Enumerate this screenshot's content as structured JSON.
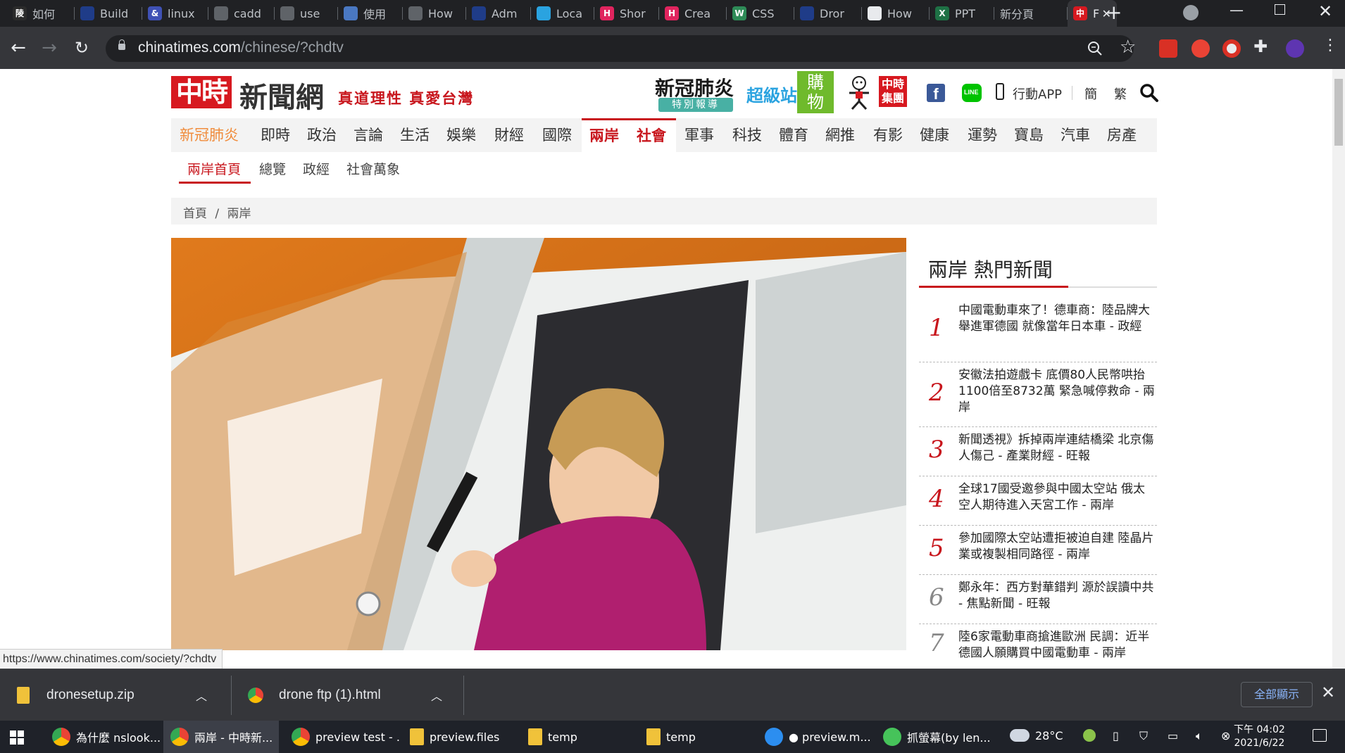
{
  "browser": {
    "tabs": [
      {
        "label": "如何",
        "fav_color": "#2b2b2b",
        "fav_glyph": "陵"
      },
      {
        "label": "Build",
        "fav_color": "#1f3c88",
        "fav_glyph": ""
      },
      {
        "label": "linux",
        "fav_color": "#3f51b5",
        "fav_glyph": "&"
      },
      {
        "label": "cadd",
        "fav_color": "#5f6368",
        "fav_glyph": ""
      },
      {
        "label": "use",
        "fav_color": "#5f6368",
        "fav_glyph": ""
      },
      {
        "label": "使用",
        "fav_color": "#4a78c2",
        "fav_glyph": ""
      },
      {
        "label": "How",
        "fav_color": "#5f6368",
        "fav_glyph": ""
      },
      {
        "label": "Adm",
        "fav_color": "#1f3c88",
        "fav_glyph": ""
      },
      {
        "label": "Loca",
        "fav_color": "#2aa3e0",
        "fav_glyph": ""
      },
      {
        "label": "Shor",
        "fav_color": "#e0245e",
        "fav_glyph": "H"
      },
      {
        "label": "Crea",
        "fav_color": "#e0245e",
        "fav_glyph": "H"
      },
      {
        "label": "CSS",
        "fav_color": "#2e8b57",
        "fav_glyph": "W"
      },
      {
        "label": "Dror",
        "fav_color": "#1f3c88",
        "fav_glyph": ""
      },
      {
        "label": "How",
        "fav_color": "#e8eaed",
        "fav_glyph": ""
      },
      {
        "label": "PPT",
        "fav_color": "#1e7145",
        "fav_glyph": "X"
      },
      {
        "label": "新分頁",
        "fav_color": "",
        "fav_glyph": ""
      },
      {
        "label": "F",
        "fav_color": "#d71920",
        "fav_glyph": "中"
      }
    ],
    "url_host": "chinatimes.com",
    "url_path": "/chinese/?chdtv",
    "status_url": "https://www.chinatimes.com/society/?chdtv"
  },
  "header": {
    "logo_mark": "中時",
    "logo_text": "新聞網",
    "slogan": "真道理性 真愛台灣",
    "covid_title": "新冠肺炎",
    "covid_sub": "特別報導",
    "supermarket": "超級站",
    "shopping": "購物",
    "group_logo": "中時集團",
    "app_label": "行動APP",
    "lang_simp": "簡",
    "lang_trad": "繁"
  },
  "nav": {
    "items": [
      "新冠肺炎",
      "即時",
      "政治",
      "言論",
      "生活",
      "娛樂",
      "財經",
      "國際",
      "兩岸",
      "社會",
      "軍事",
      "科技",
      "體育",
      "網推",
      "有影",
      "健康",
      "運勢",
      "寶島",
      "汽車",
      "房產"
    ],
    "active": "兩岸",
    "sub": [
      "兩岸首頁",
      "總覽",
      "政經",
      "社會萬象"
    ]
  },
  "breadcrumb": {
    "home": "首頁",
    "sep": "/",
    "current": "兩岸"
  },
  "hot": {
    "title": "兩岸 熱門新聞",
    "items": [
      {
        "num": "1",
        "text": "中國電動車來了！德車商：陸品牌大舉進軍德國 就像當年日本車 - 政經"
      },
      {
        "num": "2",
        "text": "安徽法拍遊戲卡 底價80人民幣哄抬1100倍至8732萬 緊急喊停救命 - 兩岸"
      },
      {
        "num": "3",
        "text": "新聞透視》拆掉兩岸連結橋梁 北京傷人傷己 - 產業財經 - 旺報"
      },
      {
        "num": "4",
        "text": "全球17國受邀參與中國太空站 俄太空人期待進入天宮工作 - 兩岸"
      },
      {
        "num": "5",
        "text": "參加國際太空站遭拒被迫自建 陸晶片業或複製相同路徑 - 兩岸"
      },
      {
        "num": "6",
        "text": "鄭永年：西方對華錯判 源於誤讀中共 - 焦點新聞 - 旺報"
      },
      {
        "num": "7",
        "text": "陸6家電動車商搶進歐洲 民調：近半德國人願購買中國電動車 - 兩岸"
      }
    ]
  },
  "downloads": {
    "items": [
      "dronesetup.zip",
      "drone ftp (1).html"
    ],
    "show_all": "全部顯示"
  },
  "taskbar": {
    "items": [
      {
        "label": "為什麼 nslook...",
        "kind": "chrome"
      },
      {
        "label": "兩岸 - 中時新...",
        "kind": "chrome"
      },
      {
        "label": "preview test - ...",
        "kind": "chrome"
      },
      {
        "label": "preview.files",
        "kind": "folder"
      },
      {
        "label": "temp",
        "kind": "folder"
      },
      {
        "label": "temp",
        "kind": "folder"
      },
      {
        "label": "● preview.m...",
        "kind": "vscode"
      },
      {
        "label": "抓螢幕(by len...",
        "kind": "capture"
      }
    ],
    "weather": "28°C",
    "time": "下午 04:02",
    "date": "2021/6/22"
  },
  "colors": {
    "brand_red": "#c8161d",
    "covid_orange": "#f08c3c"
  }
}
